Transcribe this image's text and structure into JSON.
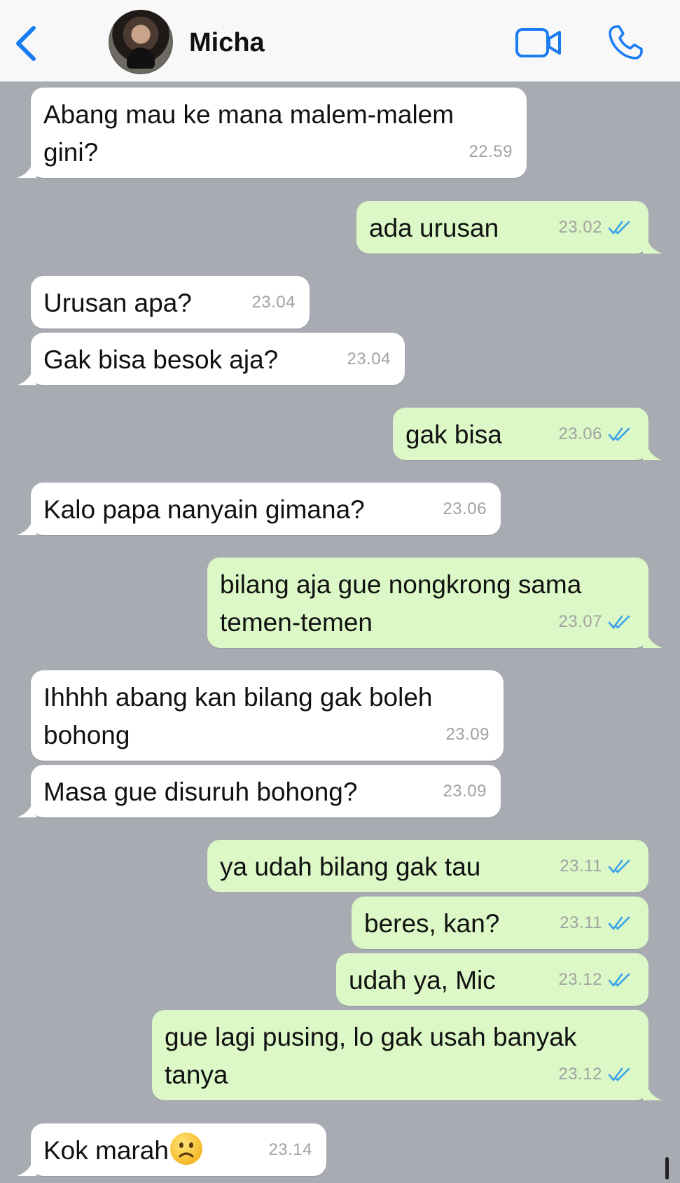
{
  "header": {
    "contact_name": "Micha",
    "icons": [
      "back-chevron-icon",
      "avatar",
      "video-call-icon",
      "phone-call-icon"
    ],
    "accent_color": "#1a7cf3"
  },
  "colors": {
    "background": "#a9abb3",
    "incoming_bubble": "#ffffff",
    "outgoing_bubble": "#dcf8c6",
    "read_ticks": "#3aa3e8"
  },
  "messages": [
    {
      "direction": "in",
      "text": "Abang mau ke mana malem-malem gini?",
      "time": "22.59"
    },
    {
      "direction": "out",
      "text": "ada urusan",
      "time": "23.02",
      "read": true
    },
    {
      "direction": "in",
      "text": "Urusan apa?",
      "time": "23.04"
    },
    {
      "direction": "in",
      "text": "Gak bisa besok aja?",
      "time": "23.04"
    },
    {
      "direction": "out",
      "text": "gak bisa",
      "time": "23.06",
      "read": true
    },
    {
      "direction": "in",
      "text": "Kalo papa nanyain gimana?",
      "time": "23.06"
    },
    {
      "direction": "out",
      "text": "bilang aja gue nongkrong sama temen-temen",
      "time": "23.07",
      "read": true
    },
    {
      "direction": "in",
      "text": "Ihhhh abang kan bilang gak boleh bohong",
      "time": "23.09"
    },
    {
      "direction": "in",
      "text": "Masa gue disuruh bohong?",
      "time": "23.09"
    },
    {
      "direction": "out",
      "text": "ya udah bilang gak tau",
      "time": "23.11",
      "read": true
    },
    {
      "direction": "out",
      "text": "beres, kan?",
      "time": "23.11",
      "read": true
    },
    {
      "direction": "out",
      "text": "udah ya, Mic",
      "time": "23.12",
      "read": true
    },
    {
      "direction": "out",
      "text": "gue lagi pusing, lo gak usah banyak tanya",
      "time": "23.12",
      "read": true
    },
    {
      "direction": "in",
      "text": "Kok marah",
      "time": "23.14",
      "emoji": "frowning-face-icon"
    }
  ]
}
